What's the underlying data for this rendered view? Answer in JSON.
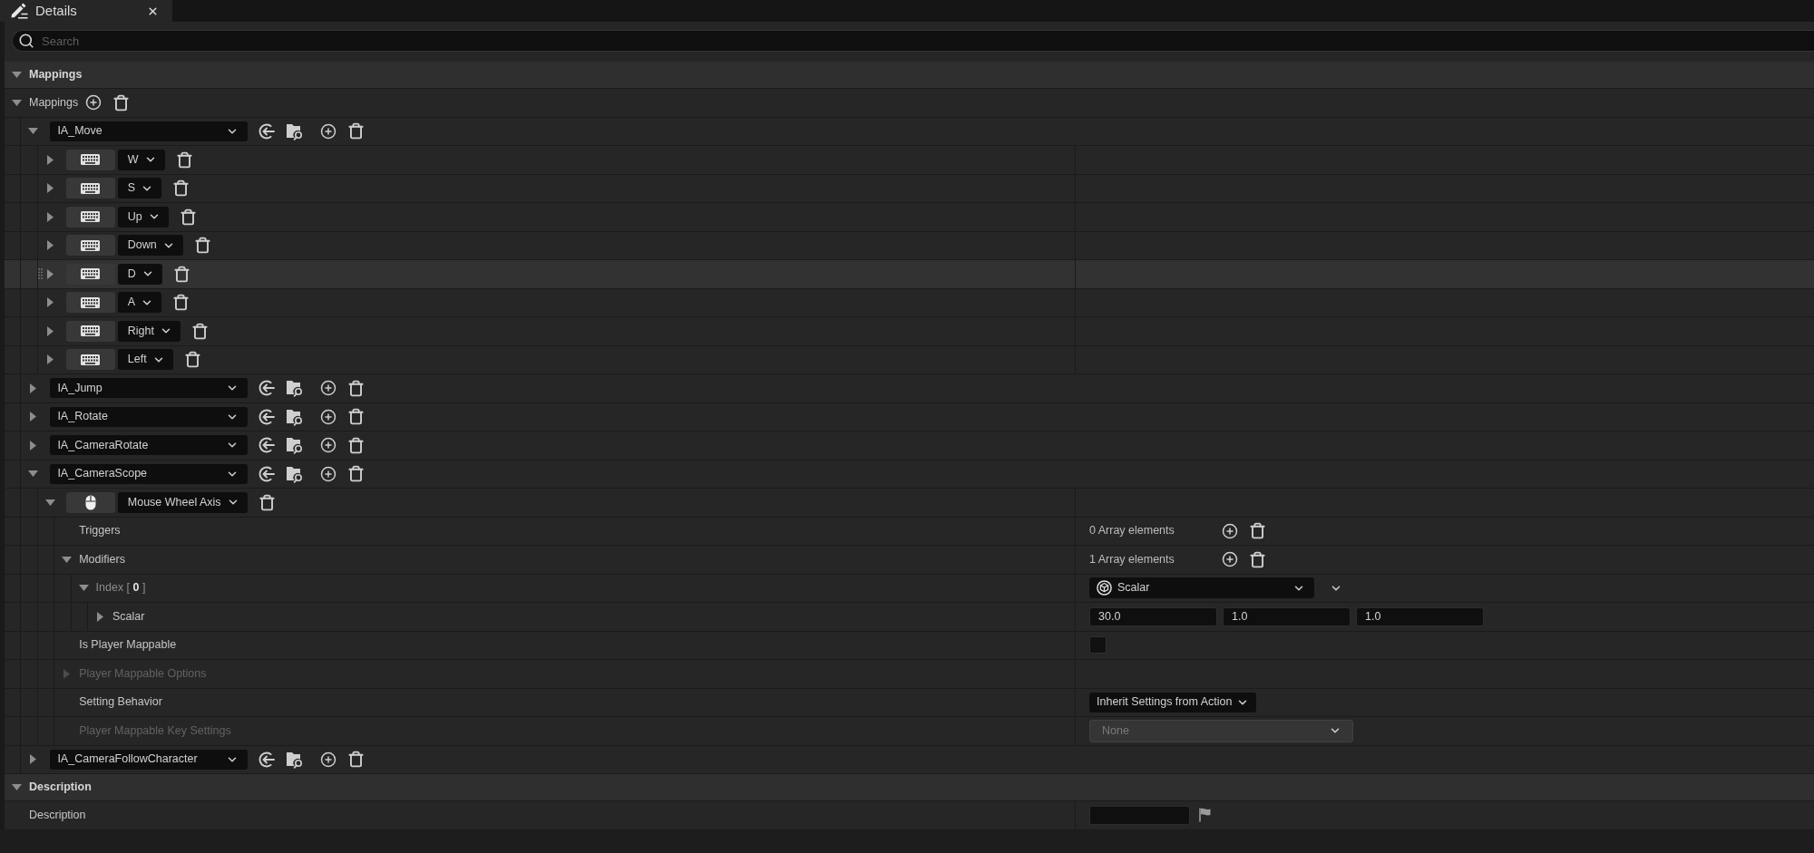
{
  "tab": {
    "title": "Details"
  },
  "search": {
    "placeholder": "Search"
  },
  "mappings_section": {
    "title": "Mappings",
    "expanded": true,
    "array": {
      "label": "Mappings",
      "expanded": true,
      "actions": [
        {
          "name": "IA_Move",
          "expanded": true,
          "keys": [
            {
              "key": "W",
              "kind": "keyboard",
              "expanded": false,
              "highlighted": false
            },
            {
              "key": "S",
              "kind": "keyboard",
              "expanded": false,
              "highlighted": false
            },
            {
              "key": "Up",
              "kind": "keyboard",
              "expanded": false,
              "highlighted": false
            },
            {
              "key": "Down",
              "kind": "keyboard",
              "expanded": false,
              "highlighted": false
            },
            {
              "key": "D",
              "kind": "keyboard",
              "expanded": false,
              "highlighted": true
            },
            {
              "key": "A",
              "kind": "keyboard",
              "expanded": false,
              "highlighted": false
            },
            {
              "key": "Right",
              "kind": "keyboard",
              "expanded": false,
              "highlighted": false
            },
            {
              "key": "Left",
              "kind": "keyboard",
              "expanded": false,
              "highlighted": false
            }
          ]
        },
        {
          "name": "IA_Jump",
          "expanded": false
        },
        {
          "name": "IA_Rotate",
          "expanded": false
        },
        {
          "name": "IA_CameraRotate",
          "expanded": false
        },
        {
          "name": "IA_CameraScope",
          "expanded": true,
          "keys": [
            {
              "key": "Mouse Wheel Axis",
              "kind": "mouse",
              "expanded": true,
              "highlighted": false,
              "properties": [
                {
                  "kind": "array",
                  "label": "Triggers",
                  "value": "0 Array elements",
                  "disabled": false
                },
                {
                  "kind": "array",
                  "label": "Modifiers",
                  "value": "1 Array elements",
                  "expanded": true,
                  "disabled": false,
                  "children": [
                    {
                      "kind": "element",
                      "label": "Index [ **0** ]",
                      "value": "Scalar",
                      "expanded": true,
                      "children": [
                        {
                          "kind": "vector",
                          "label": "Scalar",
                          "expanded": false,
                          "values": [
                            "30.0",
                            "1.0",
                            "1.0"
                          ]
                        }
                      ]
                    }
                  ]
                },
                {
                  "kind": "checkbox",
                  "label": "Is Player Mappable",
                  "checked": false,
                  "disabled": false
                },
                {
                  "kind": "group",
                  "label": "Player Mappable Options",
                  "expanded": false,
                  "disabled": true
                },
                {
                  "kind": "enum",
                  "label": "Setting Behavior",
                  "value": "Inherit Settings from Action",
                  "disabled": false
                },
                {
                  "kind": "object",
                  "label": "Player Mappable Key Settings",
                  "value": "None",
                  "disabled": true
                }
              ]
            }
          ]
        },
        {
          "name": "IA_CameraFollowCharacter",
          "expanded": false
        }
      ]
    }
  },
  "description_section": {
    "title": "Description",
    "expanded": true,
    "properties": [
      {
        "kind": "text",
        "label": "Description",
        "disabled": false
      }
    ]
  }
}
